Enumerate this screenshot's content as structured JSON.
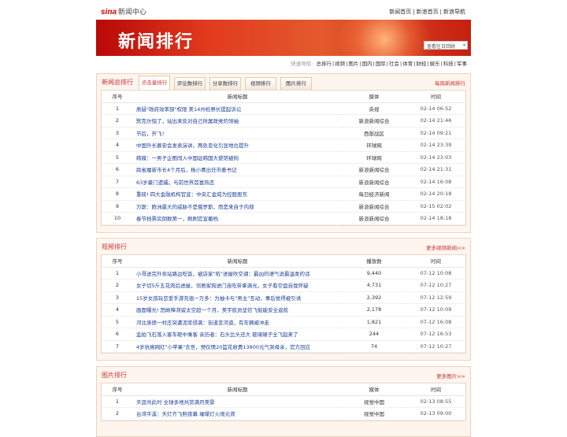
{
  "header": {
    "logo": "sina",
    "logo_suffix": "新闻中心",
    "links": [
      "新闻首页",
      "新浪首页",
      "新浪导航"
    ],
    "sep": "|"
  },
  "banner": {
    "title": "新闻排行",
    "history_placeholder": "查看往日回顾",
    "arrow": "▾"
  },
  "nav": {
    "label": "快速导航:",
    "items": [
      "总排行",
      "视频",
      "图片",
      "国内",
      "国际",
      "社会",
      "体育",
      "财经",
      "娱乐",
      "科技",
      "军事"
    ]
  },
  "news": {
    "title": "新闻总排行",
    "tabs": [
      "点击量排行",
      "评论数排行",
      "分享数排行",
      "视频排行",
      "图片排行"
    ],
    "more": "每周新闻排行",
    "cols": [
      "序号",
      "新闻标题",
      "媒体",
      "时间"
    ],
    "rows": [
      [
        "1",
        "质疑\"政府效率部\"权限 美14州检察长提起诉讼",
        "央视",
        "02-14 06:52"
      ],
      [
        "2",
        "默克尔恼了，站出来反对自己所属政党的领袖",
        "新浪新闻综合",
        "02-14 21:46"
      ],
      [
        "3",
        "节后，开飞！",
        "西部战区",
        "02-14 09:21"
      ],
      [
        "4",
        "中国外长慕安会发表演讲，两处变化引显地位提升",
        "环球网",
        "02-14 23:39"
      ],
      [
        "5",
        "韩媒：一男子企图闯入中国驻韩国大使馆被拘",
        "环球网",
        "02-14 23:03"
      ],
      [
        "6",
        "跨省履新市长4个月后，杨小菁出任市委书记",
        "新浪新闻综合",
        "02-14 21:31"
      ],
      [
        "7",
        "63岁豪门遗孀，与前世界首富热恋",
        "新浪新闻综合",
        "02-14 16:08"
      ],
      [
        "8",
        "重磅! 四大金融机构官宣：中央汇金成为控股股东",
        "每日经济新闻",
        "02-14 20:18"
      ],
      [
        "9",
        "万斯：欧洲最大的威胁不是俄罗斯，而是来自于内部",
        "新浪新闻综合",
        "02-15 02:02"
      ],
      [
        "10",
        "春节档票房倒数第一，刷刷官宣撤档",
        "新浪新闻综合",
        "02-14 18:18"
      ]
    ]
  },
  "video": {
    "title": "视频排行",
    "more": "更多视频新闻>>",
    "cols": [
      "序号",
      "新闻标题",
      "播放数",
      "时间"
    ],
    "rows": [
      [
        "1",
        "小哥送完外卖站路边吃饭，被店家\"吼\"进屋吹空调：最凶的语气说最温柔的话",
        "9,440",
        "07-12 10:08"
      ],
      [
        "2",
        "女子切5斤五花肉后进屋，邻居家狗进门连吃带拿满光，女子看空盘自我怀疑",
        "4,731",
        "07-12 10:27"
      ],
      [
        "3",
        "15岁女孩玩恋爱手游充值一万多：为抽卡与\"男主\"互动，事后觉得被引诱",
        "2,392",
        "07-12 12:59"
      ],
      [
        "4",
        "画面曝光! 因故障滞留太空超一个月，美宇航员坚信飞船能安全返航",
        "2,178",
        "07-12 10:09"
      ],
      [
        "5",
        "河北承德一村庄突遭泥浆侵袭：街道变河道，有车辆被冲走",
        "1,821",
        "07-12 16:08"
      ],
      [
        "6",
        "监拍飞石落入客车砸中乘客 亲历者：石头比头还大 玻璃碴子全飞起来了",
        "244",
        "07-12 16:53"
      ],
      [
        "7",
        "4岁抗癌网红\"小苹果\"去世，预仅情20篮花收费13800元气哭母亲，官方回应",
        "74",
        "07-12 10:27"
      ]
    ]
  },
  "photo": {
    "title": "图片排行",
    "more": "更多图片>>",
    "cols": [
      "序号",
      "新闻标题",
      "媒体",
      "时间"
    ],
    "rows": [
      [
        "1",
        "天涯共此时 全球多地共赏满月美景",
        "视觉中国",
        "02-13 08:55"
      ],
      [
        "2",
        "台湾平溪：天灯齐飞照夜幕 璀璨灯火闹元宵",
        "视觉中国",
        "02-13 09:00"
      ]
    ]
  }
}
